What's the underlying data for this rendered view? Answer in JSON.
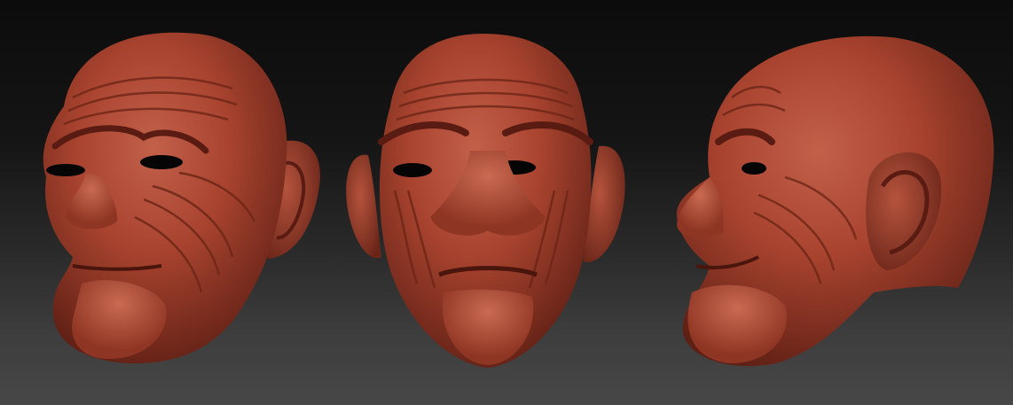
{
  "scene": {
    "background_top": "#0c0c0c",
    "background_bottom": "#474747",
    "material_color": "#a8432f",
    "material_shadow": "#5e1f14",
    "material_highlight": "#c96a52"
  },
  "views": [
    {
      "icon": "sculpted-head-three-quarter-left"
    },
    {
      "icon": "sculpted-head-front"
    },
    {
      "icon": "sculpted-head-profile-left"
    }
  ]
}
